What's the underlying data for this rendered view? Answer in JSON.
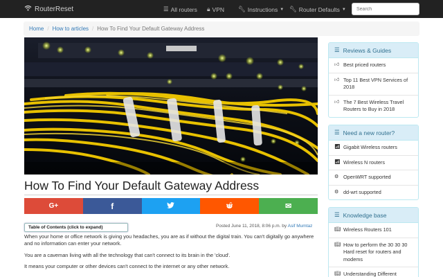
{
  "navbar": {
    "brand": "RouterReset",
    "items": [
      {
        "label": "All routers",
        "icon": "list-icon"
      },
      {
        "label": "VPN",
        "icon": "lock-icon"
      },
      {
        "label": "Instructions",
        "icon": "wrench-icon"
      },
      {
        "label": "Router Defaults",
        "icon": "wrench-icon"
      }
    ],
    "search_placeholder": "Search"
  },
  "breadcrumb": [
    "Home",
    "How to articles",
    "How To Find Your Default Gateway Address"
  ],
  "article": {
    "title": "How To Find Your Default Gateway Address",
    "toc_label": "Table of Contents (click to expand)",
    "posted_prefix": "Posted June 11, 2018, 8:06 p.m. by",
    "author": "Asif Mumtaz",
    "paragraphs": [
      "When your home or office network is giving you headaches, you are as if without the digital train. You can't digitally go anywhere and no information can enter your network.",
      "You are a caveman living with all the technology that can't connect to its brain in the 'cloud'.",
      "It means your computer or other devices can't connect to the internet or any other network."
    ]
  },
  "share": [
    {
      "name": "google-plus",
      "glyph": "G+",
      "color": "#dd4b39"
    },
    {
      "name": "facebook",
      "glyph": "f",
      "color": "#3b5998"
    },
    {
      "name": "twitter",
      "glyph": "🐦",
      "color": "#1da1f2"
    },
    {
      "name": "reddit",
      "glyph": "👽",
      "color": "#ff5700"
    },
    {
      "name": "email",
      "glyph": "✉",
      "color": "#4caf50"
    }
  ],
  "sidebar": {
    "reviews": {
      "heading": "Reviews & Guides",
      "items": [
        "Best priced routers",
        "Top 11 Best VPN Services of 2018",
        "The 7 Best Wireless Travel Routers to Buy in 2018"
      ]
    },
    "new_router": {
      "heading": "Need a new router?",
      "items": [
        "Gigabit Wireless routers",
        "Wireless N routers",
        "OpenWRT supported",
        "dd-wrt supported"
      ]
    },
    "knowledge": {
      "heading": "Knowledge base",
      "items": [
        "Wireless Routers 101",
        "How to perform the 30 30 30 Hard reset for routers and modems",
        "Understanding Different"
      ]
    }
  }
}
